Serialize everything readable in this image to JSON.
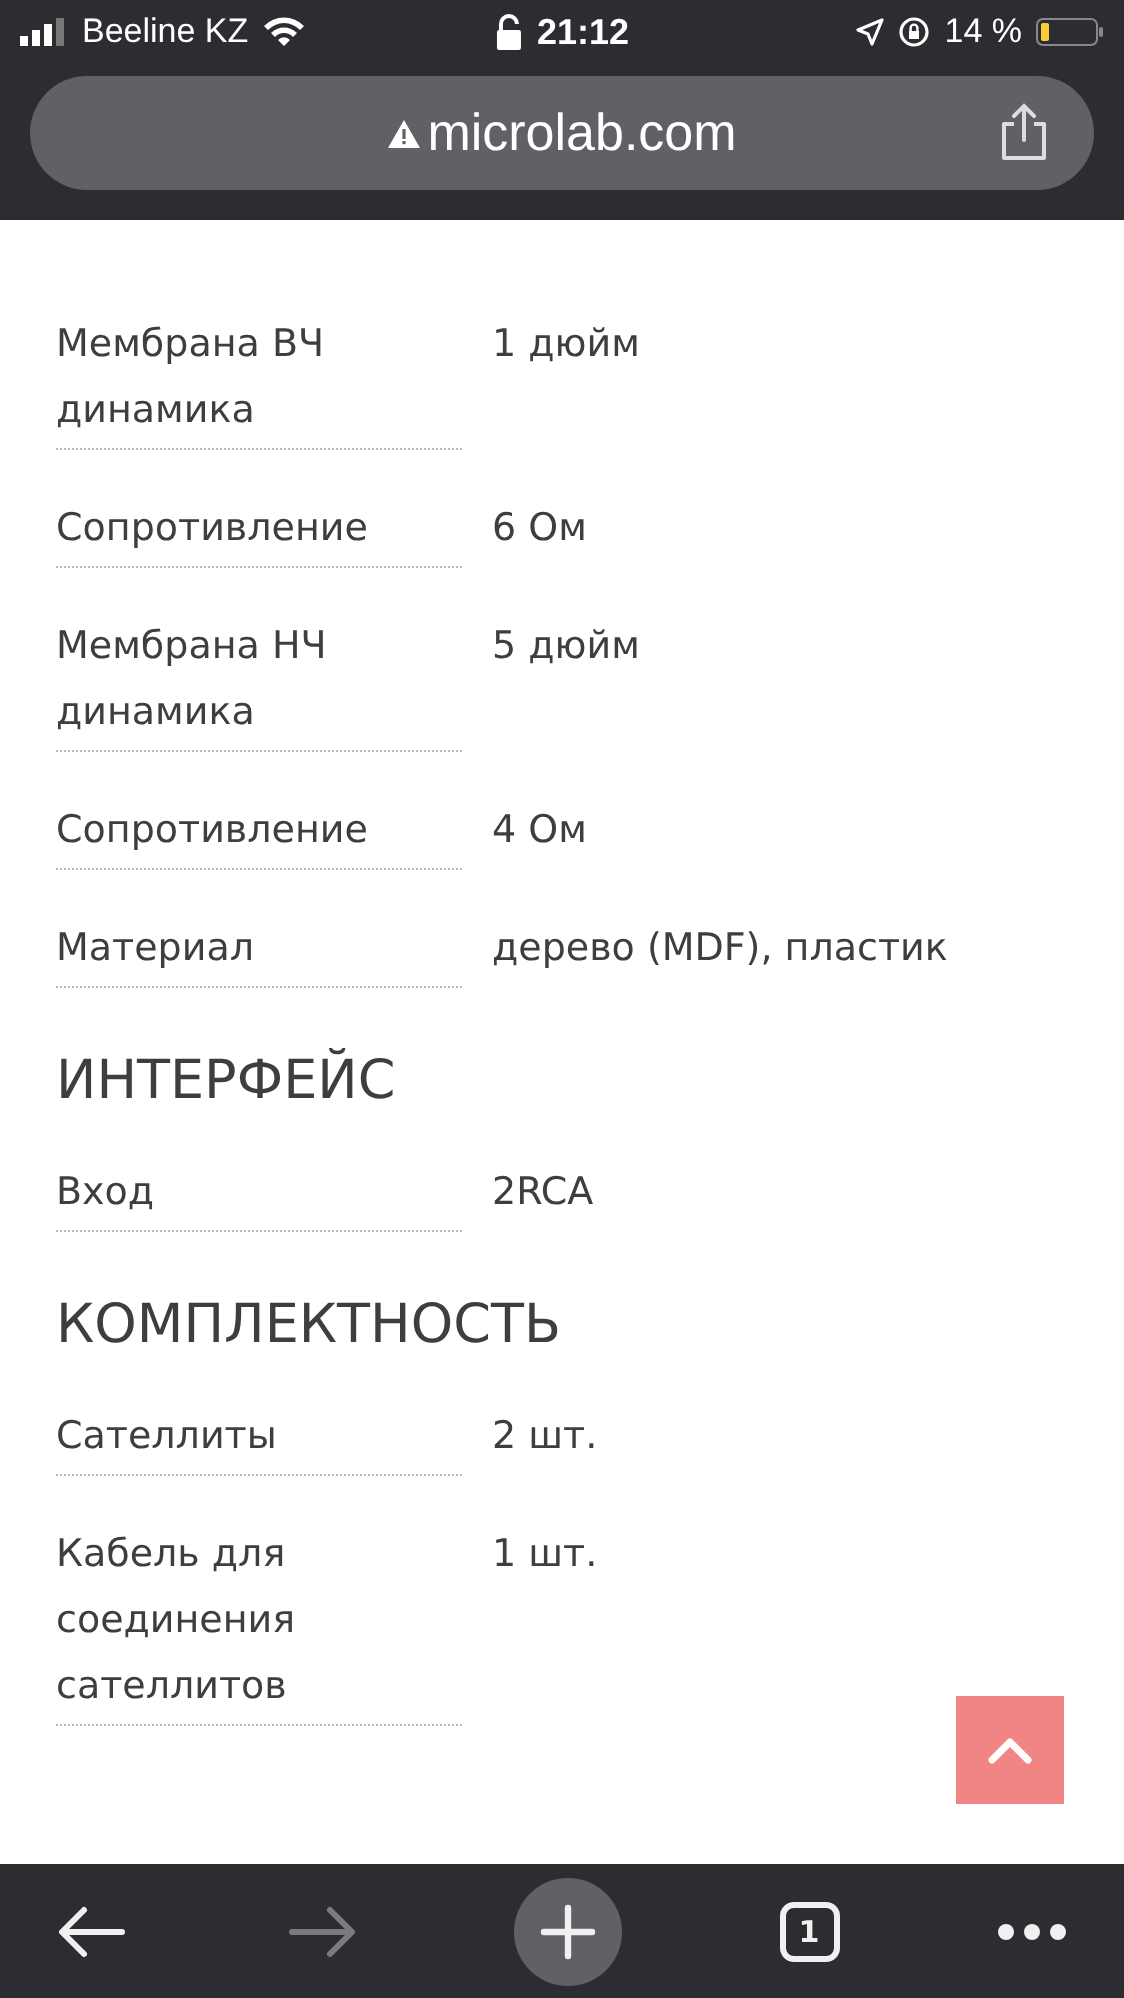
{
  "status_bar": {
    "carrier": "Beeline KZ",
    "time": "21:12",
    "battery": "14 %"
  },
  "address_bar": {
    "url": "microlab.com"
  },
  "sections": [
    {
      "rows": [
        {
          "label": "Мембрана ВЧ динамика",
          "value": "1 дюйм"
        },
        {
          "label": "Сопротивление",
          "value": "6 Ом"
        },
        {
          "label": "Мембрана НЧ динамика",
          "value": "5 дюйм"
        },
        {
          "label": "Сопротивление",
          "value": "4 Ом"
        },
        {
          "label": "Материал",
          "value": "дерево (MDF), пластик"
        }
      ]
    },
    {
      "title": "ИНТЕРФЕЙС",
      "rows": [
        {
          "label": "Вход",
          "value": "2RCA"
        }
      ]
    },
    {
      "title": "КОМПЛЕКТНОСТЬ",
      "rows": [
        {
          "label": "Сателлиты",
          "value": "2 шт."
        },
        {
          "label": "Кабель для соединения сателлитов",
          "value": "1 шт."
        }
      ]
    }
  ],
  "toolbar": [
    {
      "kind": "back",
      "disabled": false
    },
    {
      "kind": "forward",
      "disabled": true
    },
    {
      "kind": "new-tab",
      "disabled": false
    },
    {
      "kind": "tabs",
      "count": "1",
      "disabled": false
    },
    {
      "kind": "more",
      "disabled": false
    }
  ]
}
